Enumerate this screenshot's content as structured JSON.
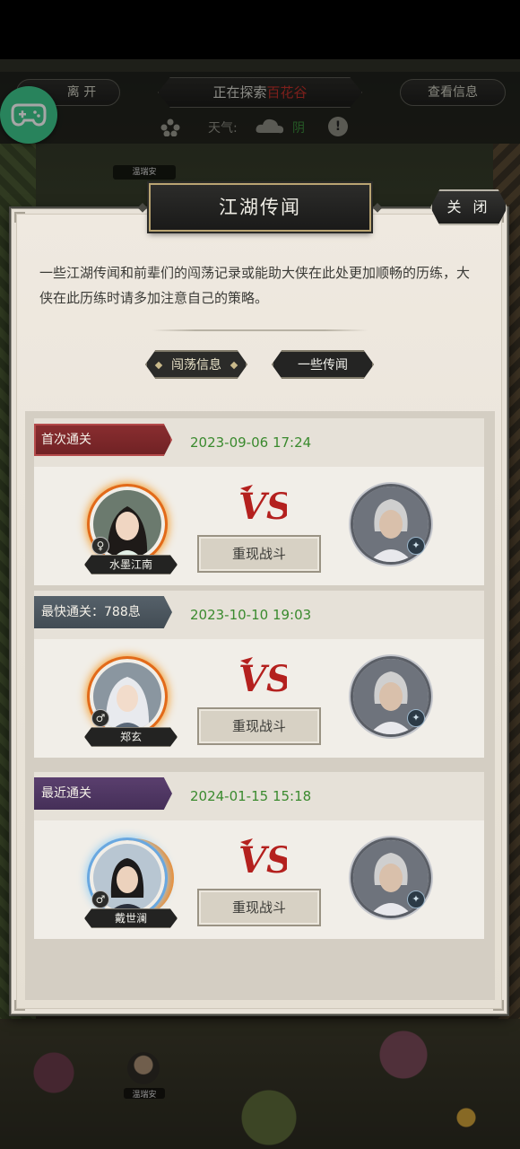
{
  "hud": {
    "leave_label": "离 开",
    "explore_prefix": "正在探索",
    "explore_place": "百花谷",
    "info_label": "查看信息",
    "weather_label": "天气:",
    "weather_value": "阴",
    "help_symbol": "!"
  },
  "background": {
    "npc_top_label": "温瑞安",
    "npc_bottom_label": "温瑞安"
  },
  "panel": {
    "title": "江湖传闻",
    "close_label": "关 闭",
    "intro": "一些江湖传闻和前辈们的闯荡记录或能助大侠在此处更加顺畅的历练，大侠在此历练时请多加注意自己的策略。",
    "tabs": [
      {
        "label": "闯荡信息"
      },
      {
        "label": "一些传闻"
      }
    ]
  },
  "records": [
    {
      "label": "首次通关",
      "label_color": "red",
      "time": "2023-09-06 17:24",
      "player_name": "水墨江南",
      "player_gender": "♀",
      "replay_label": "重现战斗",
      "vs_label": "VS"
    },
    {
      "label": "最快通关：788息",
      "label_color": "gray",
      "time": "2023-10-10 19:03",
      "player_name": "郑玄",
      "player_gender": "♂",
      "replay_label": "重现战斗",
      "vs_label": "VS"
    },
    {
      "label": "最近通关",
      "label_color": "purple",
      "time": "2024-01-15 15:18",
      "player_name": "戴世澜",
      "player_gender": "♂",
      "replay_label": "重现战斗",
      "vs_label": "VS"
    }
  ],
  "colors": {
    "accent_green": "#3ec98e",
    "time_green": "#3a8a2e",
    "ribbon_red": "#8a2e30",
    "ribbon_gray": "#56616a",
    "ribbon_purple": "#5a3f6e",
    "vs_red": "#b4201e"
  },
  "icons": {
    "controller": "gamepad-icon",
    "weather": "cloud-icon",
    "flower": "flower-icon",
    "help": "help-icon",
    "enemy_badge": "sword-icon"
  }
}
